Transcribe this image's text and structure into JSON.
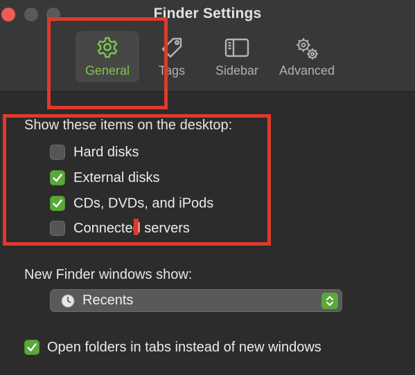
{
  "window": {
    "title": "Finder Settings"
  },
  "tabs": [
    {
      "label": "General",
      "icon": "gear-icon",
      "active": true
    },
    {
      "label": "Tags",
      "icon": "tag-icon",
      "active": false
    },
    {
      "label": "Sidebar",
      "icon": "sidebar-icon",
      "active": false
    },
    {
      "label": "Advanced",
      "icon": "gears-icon",
      "active": false
    }
  ],
  "desktop": {
    "heading": "Show these items on the desktop:",
    "items": [
      {
        "label": "Hard disks",
        "checked": false
      },
      {
        "label": "External disks",
        "checked": true
      },
      {
        "label": "CDs, DVDs, and iPods",
        "checked": true
      },
      {
        "label": "Connected servers",
        "checked": false
      }
    ]
  },
  "new_window": {
    "heading": "New Finder windows show:",
    "selected": "Recents",
    "icon": "clock-icon"
  },
  "tabs_option": {
    "label": "Open folders in tabs instead of new windows",
    "checked": true
  },
  "colors": {
    "accent": "#5aa83a",
    "accent_text": "#7fc64e",
    "annotation": "#e1392c",
    "close_button": "#ee5c55"
  }
}
